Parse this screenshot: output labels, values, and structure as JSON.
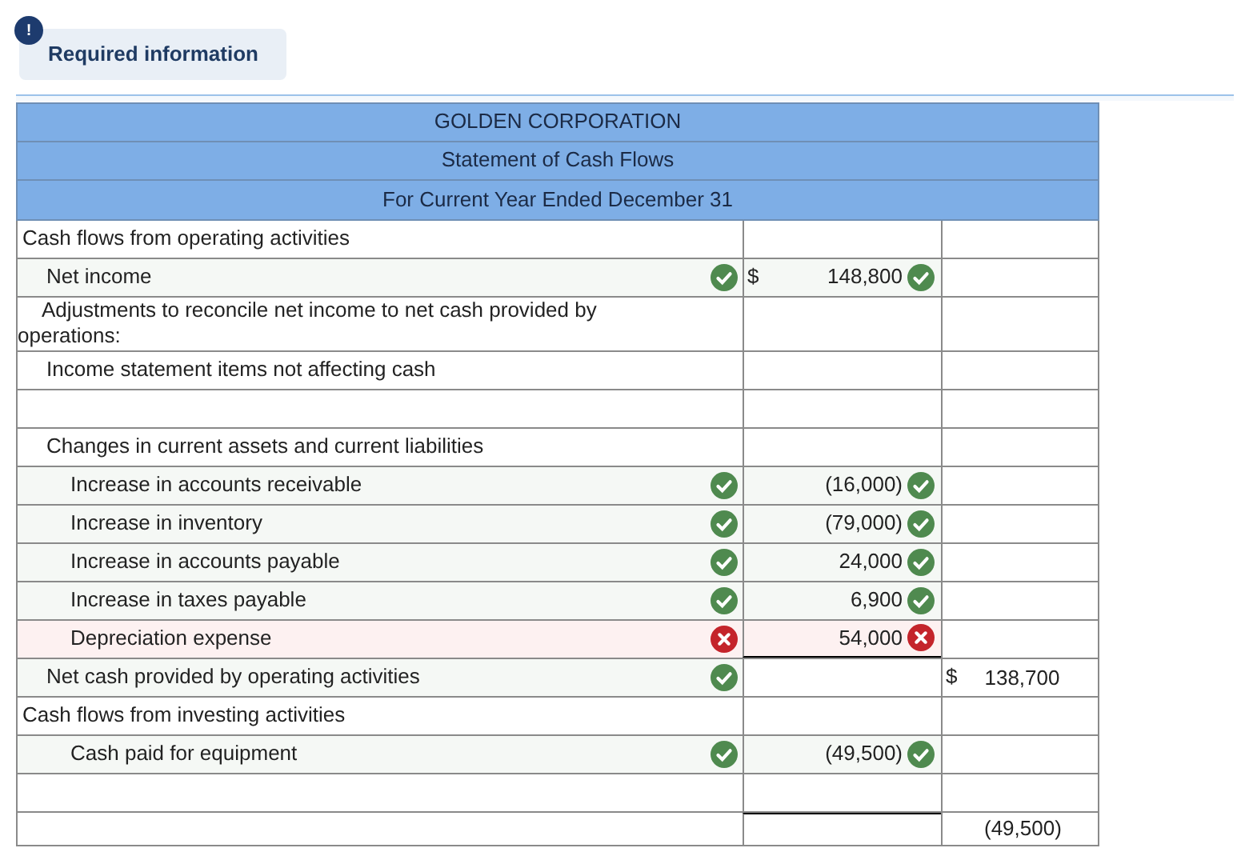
{
  "notice": {
    "icon": "!",
    "label": "Required information"
  },
  "statement": {
    "title_lines": [
      "GOLDEN CORPORATION",
      "Statement of Cash Flows",
      "For Current Year Ended December 31"
    ],
    "rows": [
      {
        "kind": "section",
        "label": "Cash flows from operating activities"
      },
      {
        "kind": "sub",
        "label": "Net income",
        "correct": true,
        "amount_currency": "$",
        "amount": "148,800",
        "amount_correct": true
      },
      {
        "kind": "wrap",
        "label": "Adjustments to reconcile net income to net cash provided by operations:"
      },
      {
        "kind": "sub",
        "label": "Income statement items not affecting cash"
      },
      {
        "kind": "blank"
      },
      {
        "kind": "sub",
        "label": "Changes in current assets and current liabilities"
      },
      {
        "kind": "detail",
        "label": "Increase in accounts receivable",
        "correct": true,
        "amount": "(16,000)",
        "amount_correct": true
      },
      {
        "kind": "detail",
        "label": "Increase in inventory",
        "correct": true,
        "amount": "(79,000)",
        "amount_correct": true
      },
      {
        "kind": "detail",
        "label": "Increase in accounts payable",
        "correct": true,
        "amount": "24,000",
        "amount_correct": true
      },
      {
        "kind": "detail",
        "label": "Increase in taxes payable",
        "correct": true,
        "amount": "6,900",
        "amount_correct": true
      },
      {
        "kind": "detail",
        "label": "Depreciation expense",
        "correct": false,
        "amount": "54,000",
        "amount_correct": false,
        "underline": true
      },
      {
        "kind": "sub",
        "label": "Net cash provided by operating activities",
        "correct": true,
        "total_currency": "$",
        "total": "138,700"
      },
      {
        "kind": "section",
        "label": "Cash flows from investing activities"
      },
      {
        "kind": "detail",
        "label": "Cash paid for equipment",
        "correct": true,
        "amount": "(49,500)",
        "amount_correct": true
      },
      {
        "kind": "blank"
      },
      {
        "kind": "closing",
        "overline": true,
        "total": "(49,500)"
      }
    ]
  }
}
